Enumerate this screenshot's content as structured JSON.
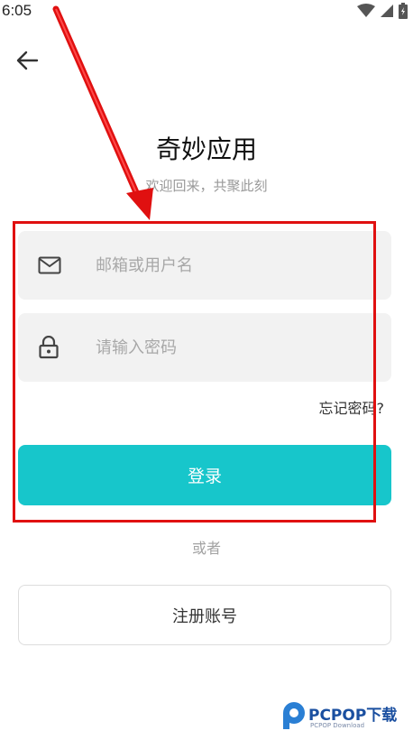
{
  "status_bar": {
    "time": "6:05",
    "icons": [
      "wifi-icon",
      "cell-signal-icon",
      "battery-icon"
    ]
  },
  "header": {
    "back_icon": "arrow-left-icon"
  },
  "app": {
    "title": "奇妙应用",
    "subtitle": "欢迎回来，共聚此刻"
  },
  "form": {
    "email": {
      "icon": "mail-icon",
      "placeholder": "邮箱或用户名",
      "value": ""
    },
    "password": {
      "icon": "lock-icon",
      "placeholder": "请输入密码",
      "value": ""
    },
    "forgot_label": "忘记密码?",
    "login_label": "登录",
    "or_label": "或者",
    "register_label": "注册账号"
  },
  "watermark": {
    "brand": "PCPOP下载",
    "sub": "PCPOP Download"
  },
  "colors": {
    "accent": "#17c6cb",
    "field_bg": "#f2f2f2",
    "annotation": "#e01010"
  }
}
